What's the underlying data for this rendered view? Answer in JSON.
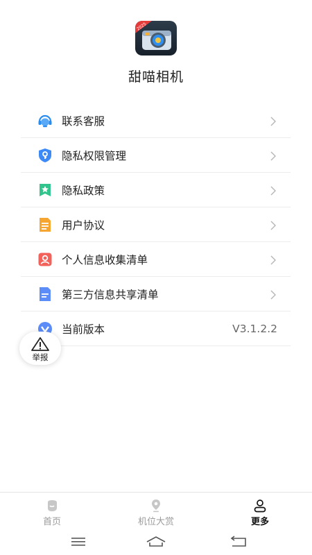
{
  "app": {
    "name": "甜喵相机",
    "icon": "camera-app-icon",
    "icon_badge": "2025"
  },
  "menu": {
    "items": [
      {
        "label": "联系客服",
        "icon": "headset-icon",
        "color": "#2b8cf0",
        "has_chevron": true
      },
      {
        "label": "隐私权限管理",
        "icon": "shield-icon",
        "color": "#3d8af7",
        "has_chevron": true
      },
      {
        "label": "隐私政策",
        "icon": "bookmark-star-icon",
        "color": "#31c48d",
        "has_chevron": true
      },
      {
        "label": "用户协议",
        "icon": "document-icon",
        "color": "#f7a531",
        "has_chevron": true
      },
      {
        "label": "个人信息收集清单",
        "icon": "user-card-icon",
        "color": "#f2615a",
        "has_chevron": true
      },
      {
        "label": "第三方信息共享清单",
        "icon": "file-icon",
        "color": "#5b8cf7",
        "has_chevron": true
      },
      {
        "label": "当前版本",
        "icon": "version-icon",
        "color": "#5b8cf7",
        "has_chevron": false,
        "value": "V3.1.2.2"
      }
    ]
  },
  "report": {
    "label": "举报",
    "icon": "warning-icon"
  },
  "tabs": [
    {
      "label": "首页",
      "icon": "home-icon",
      "active": false
    },
    {
      "label": "机位大赏",
      "icon": "location-pin-icon",
      "active": false
    },
    {
      "label": "更多",
      "icon": "person-icon",
      "active": true
    }
  ],
  "system_nav": [
    "menu-icon",
    "home-outline-icon",
    "back-icon"
  ]
}
